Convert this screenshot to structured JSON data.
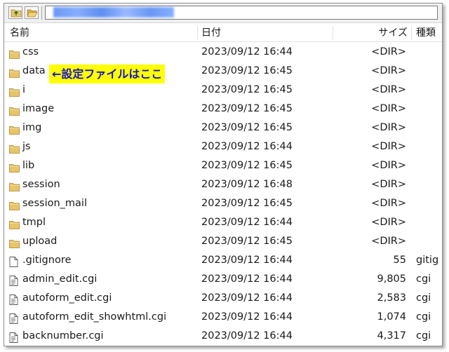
{
  "header": {
    "name": "名前",
    "date": "日付",
    "size": "サイズ",
    "type": "種類"
  },
  "annotation": "←設定ファイルはここ",
  "rows": [
    {
      "name": "css",
      "date": "2023/09/12 16:44",
      "size": "<DIR>",
      "type": "",
      "icon": "folder-icon"
    },
    {
      "name": "data",
      "date": "2023/09/12 16:45",
      "size": "<DIR>",
      "type": "",
      "icon": "folder-icon"
    },
    {
      "name": "i",
      "date": "2023/09/12 16:45",
      "size": "<DIR>",
      "type": "",
      "icon": "folder-icon"
    },
    {
      "name": "image",
      "date": "2023/09/12 16:45",
      "size": "<DIR>",
      "type": "",
      "icon": "folder-icon"
    },
    {
      "name": "img",
      "date": "2023/09/12 16:45",
      "size": "<DIR>",
      "type": "",
      "icon": "folder-icon"
    },
    {
      "name": "js",
      "date": "2023/09/12 16:44",
      "size": "<DIR>",
      "type": "",
      "icon": "folder-icon"
    },
    {
      "name": "lib",
      "date": "2023/09/12 16:45",
      "size": "<DIR>",
      "type": "",
      "icon": "folder-icon"
    },
    {
      "name": "session",
      "date": "2023/09/12 16:48",
      "size": "<DIR>",
      "type": "",
      "icon": "folder-icon"
    },
    {
      "name": "session_mail",
      "date": "2023/09/12 16:45",
      "size": "<DIR>",
      "type": "",
      "icon": "folder-icon"
    },
    {
      "name": "tmpl",
      "date": "2023/09/12 16:44",
      "size": "<DIR>",
      "type": "",
      "icon": "folder-icon"
    },
    {
      "name": "upload",
      "date": "2023/09/12 16:45",
      "size": "<DIR>",
      "type": "",
      "icon": "folder-icon"
    },
    {
      "name": ".gitignore",
      "date": "2023/09/12 16:44",
      "size": "55",
      "type": "gitig",
      "icon": "file-icon"
    },
    {
      "name": "admin_edit.cgi",
      "date": "2023/09/12 16:44",
      "size": "9,805",
      "type": "cgi",
      "icon": "script-file-icon"
    },
    {
      "name": "autoform_edit.cgi",
      "date": "2023/09/12 16:44",
      "size": "2,583",
      "type": "cgi",
      "icon": "script-file-icon"
    },
    {
      "name": "autoform_edit_showhtml.cgi",
      "date": "2023/09/12 16:44",
      "size": "1,074",
      "type": "cgi",
      "icon": "script-file-icon"
    },
    {
      "name": "backnumber.cgi",
      "date": "2023/09/12 16:44",
      "size": "4,317",
      "type": "cgi",
      "icon": "script-file-icon"
    }
  ],
  "colors": {
    "annotation_bg": "#ffff00",
    "annotation_text": "#1515c8",
    "folder": "#e8c56a"
  }
}
